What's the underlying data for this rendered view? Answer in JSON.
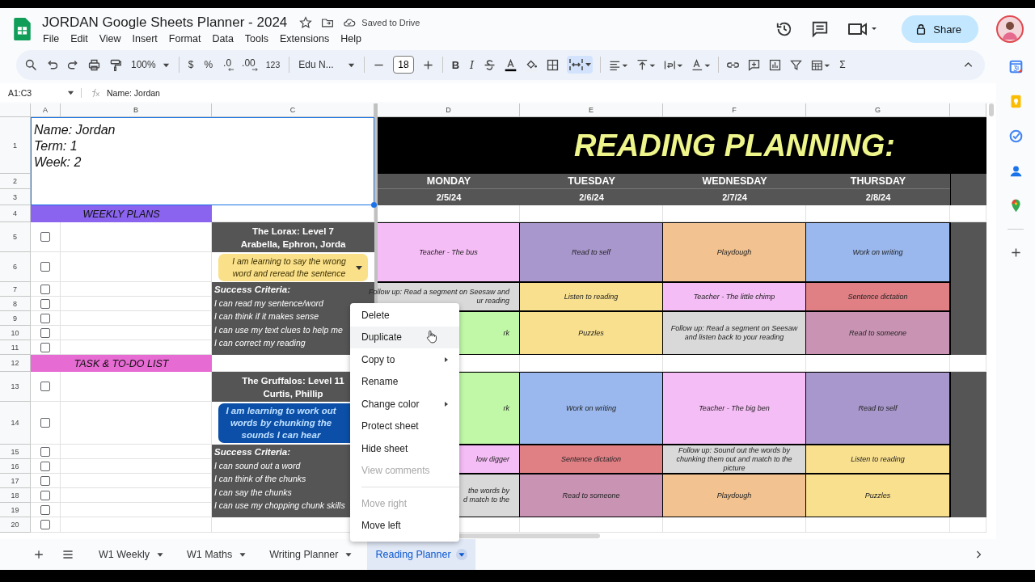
{
  "document": {
    "title": "JORDAN Google Sheets Planner - 2024",
    "save_status": "Saved to Drive"
  },
  "menu_bar": [
    "File",
    "Edit",
    "View",
    "Insert",
    "Format",
    "Data",
    "Tools",
    "Extensions",
    "Help"
  ],
  "share_button": "Share",
  "toolbar": {
    "zoom": "100%",
    "currency": "$",
    "percent": "%",
    "decrease_decimal": ".0",
    "increase_decimal": ".00",
    "number_format": "123",
    "font": "Edu N...",
    "font_size": "18",
    "bold": "B",
    "italic": "I",
    "functions": "Σ",
    "merge_active": true
  },
  "formula_bar": {
    "cell_range": "A1:C3",
    "formula": "Name: Jordan"
  },
  "columns": [
    "A",
    "B",
    "C",
    "D",
    "E",
    "F",
    "G"
  ],
  "row_numbers": [
    "1",
    "2",
    "3",
    "4",
    "5",
    "6",
    "7",
    "8",
    "9",
    "10",
    "11",
    "12",
    "13",
    "14",
    "15",
    "16",
    "17",
    "18",
    "19",
    "20"
  ],
  "student_info": [
    "Name: Jordan",
    "Term: 1",
    "Week: 2"
  ],
  "banner": "READING PLANNING:",
  "days": [
    {
      "day": "MONDAY",
      "date": "2/5/24"
    },
    {
      "day": "TUESDAY",
      "date": "2/6/24"
    },
    {
      "day": "WEDNESDAY",
      "date": "2/7/24"
    },
    {
      "day": "THURSDAY",
      "date": "2/8/24"
    }
  ],
  "weekly_plans_header": "WEEKLY PLANS",
  "task_list_header": "TASK & TO-DO LIST",
  "plan_checkboxes": [
    {
      "checked": false
    },
    {
      "checked": false
    },
    {
      "checked": false
    },
    {
      "checked": false
    },
    {
      "checked": false
    },
    {
      "checked": false
    },
    {
      "checked": false
    }
  ],
  "task_checkboxes": [
    {
      "checked": false
    },
    {
      "checked": false
    },
    {
      "checked": false
    },
    {
      "checked": false
    },
    {
      "checked": false
    },
    {
      "checked": false
    },
    {
      "checked": false
    },
    {
      "checked": false
    }
  ],
  "groups": [
    {
      "title": "The Lorax: Level 7",
      "members": "Arabella, Ephron, Jorda",
      "goal": "I am learning to say the wrong word and reread the sentence",
      "color": "#fbe08a",
      "criteria_heading": "Success Criteria:",
      "criteria": [
        "I can read my sentence/word",
        "I can think if it makes sense",
        "I can use my text clues to help me",
        "I can correct my reading"
      ],
      "schedule": [
        [
          {
            "text": "Teacher - The bus",
            "color": "#f5bdf5",
            "kind": "full"
          },
          {
            "text": "Read to self",
            "color": "#a897cc",
            "kind": "full"
          },
          {
            "text": "Playdough",
            "color": "#f2c290",
            "kind": "full"
          },
          {
            "text": "Work on writing",
            "color": "#9ab8ee",
            "kind": "full"
          }
        ],
        [
          {
            "text": "Follow up: Read a segment on Seesaw and\nur reading",
            "color": "#d9d9d9",
            "kind": "covered"
          },
          {
            "text": "Listen to reading",
            "color": "#f9e08f",
            "kind": "full"
          },
          {
            "text": "Teacher - The little chimp",
            "color": "#f5bdf5",
            "kind": "full"
          },
          {
            "text": "Sentence dictation",
            "color": "#e08085",
            "kind": "full"
          }
        ],
        [
          {
            "text": "rk",
            "color": "#c1f8a8",
            "kind": "covered"
          },
          {
            "text": "Puzzles",
            "color": "#f9e08f",
            "kind": "full"
          },
          {
            "text": "Follow up: Read a segment on Seesaw and listen back to your reading",
            "color": "#d9d9d9",
            "kind": "full"
          },
          {
            "text": "Read to someone",
            "color": "#c994b4",
            "kind": "full"
          }
        ]
      ]
    },
    {
      "title": "The Gruffalos: Level 11",
      "members": "Curtis, Phillip",
      "goal": "I am learning to work out words by chunking the sounds I can hear",
      "color": "#0b4fa8",
      "criteria_heading": "Success Criteria:",
      "criteria": [
        "I can sound out a word",
        "I can think of the chunks",
        "I can say the chunks",
        "I can use my chopping chunk skills"
      ],
      "schedule": [
        [
          {
            "text": "rk",
            "color": "#c1f8a8",
            "kind": "covered"
          },
          {
            "text": "Work on writing",
            "color": "#9ab8ee",
            "kind": "full"
          },
          {
            "text": "Teacher - The big ben",
            "color": "#f5bdf5",
            "kind": "full"
          },
          {
            "text": "Read to self",
            "color": "#a897cc",
            "kind": "full"
          }
        ],
        [
          {
            "text": "low digger",
            "color": "#f5bdf5",
            "kind": "covered"
          },
          {
            "text": "Sentence dictation",
            "color": "#e08085",
            "kind": "full"
          },
          {
            "text": "Follow up: Sound out the words by chunking them out and match to the picture",
            "color": "#d9d9d9",
            "kind": "full"
          },
          {
            "text": "Listen to reading",
            "color": "#f9e08f",
            "kind": "full"
          }
        ],
        [
          {
            "text": "the words by\nd match to the",
            "color": "#d9d9d9",
            "kind": "covered"
          },
          {
            "text": "Read to someone",
            "color": "#c994b4",
            "kind": "full"
          },
          {
            "text": "Playdough",
            "color": "#f2c290",
            "kind": "full"
          },
          {
            "text": "Puzzles",
            "color": "#f9e08f",
            "kind": "full"
          }
        ]
      ]
    }
  ],
  "context_menu": [
    {
      "kind": "item",
      "label": "Delete",
      "hovered": false,
      "disabled": false,
      "submenu": false
    },
    {
      "kind": "item",
      "label": "Duplicate",
      "hovered": true,
      "disabled": false,
      "submenu": false
    },
    {
      "kind": "item",
      "label": "Copy to",
      "hovered": false,
      "disabled": false,
      "submenu": true
    },
    {
      "kind": "item",
      "label": "Rename",
      "hovered": false,
      "disabled": false,
      "submenu": false
    },
    {
      "kind": "item",
      "label": "Change color",
      "hovered": false,
      "disabled": false,
      "submenu": true
    },
    {
      "kind": "item",
      "label": "Protect sheet",
      "hovered": false,
      "disabled": false,
      "submenu": false
    },
    {
      "kind": "item",
      "label": "Hide sheet",
      "hovered": false,
      "disabled": false,
      "submenu": false
    },
    {
      "kind": "item",
      "label": "View comments",
      "hovered": false,
      "disabled": true,
      "submenu": false
    },
    {
      "kind": "separator"
    },
    {
      "kind": "item",
      "label": "Move right",
      "hovered": false,
      "disabled": true,
      "submenu": false
    },
    {
      "kind": "item",
      "label": "Move left",
      "hovered": false,
      "disabled": false,
      "submenu": false
    }
  ],
  "sheet_tabs": [
    {
      "label": "W1 Weekly",
      "selected": false
    },
    {
      "label": "W1 Maths",
      "selected": false
    },
    {
      "label": "Writing Planner",
      "selected": false
    },
    {
      "label": "Reading Planner",
      "selected": true
    }
  ]
}
